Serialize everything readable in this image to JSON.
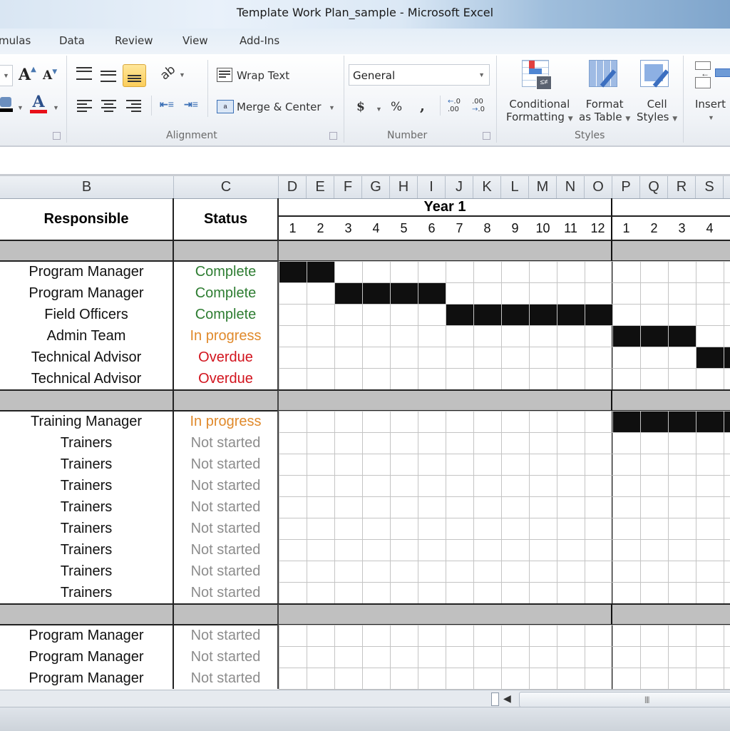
{
  "window": {
    "title": "Template Work Plan_sample  -  Microsoft Excel"
  },
  "ribbon_tabs": [
    "mulas",
    "Data",
    "Review",
    "View",
    "Add-Ins"
  ],
  "ribbon": {
    "font_group": {
      "increase_font_icon": "font-grow-icon",
      "decrease_font_icon": "font-shrink-icon",
      "fill_color_icon": "fill-color-icon",
      "font_color_icon": "font-color-icon"
    },
    "alignment": {
      "label": "Alignment",
      "wrap_text": "Wrap Text",
      "merge_center": "Merge & Center"
    },
    "number": {
      "label": "Number",
      "format_value": "General",
      "currency": "$",
      "percent": "%",
      "comma": ",",
      "increase_decimal": "←.0 .00",
      "decrease_decimal": ".00 →.0"
    },
    "styles": {
      "label": "Styles",
      "conditional_formatting_1": "Conditional",
      "conditional_formatting_2": "Formatting",
      "format_table_1": "Format",
      "format_table_2": "as Table",
      "cell_styles_1": "Cell",
      "cell_styles_2": "Styles"
    },
    "cells": {
      "insert": "Insert"
    }
  },
  "columns": [
    "B",
    "C",
    "D",
    "E",
    "F",
    "G",
    "H",
    "I",
    "J",
    "K",
    "L",
    "M",
    "N",
    "O",
    "P",
    "Q",
    "R",
    "S"
  ],
  "sheet": {
    "header_responsible": "Responsible",
    "header_status": "Status",
    "year_label": "Year 1",
    "months_year1": [
      "1",
      "2",
      "3",
      "4",
      "5",
      "6",
      "7",
      "8",
      "9",
      "10",
      "11",
      "12"
    ],
    "months_year2": [
      "1",
      "2",
      "3",
      "4"
    ],
    "status_colors": {
      "Complete": "#2e7d32",
      "In progress": "#e08a2c",
      "Overdue": "#d2141e",
      "Not started": "#8c8c8c"
    },
    "sections": [
      {
        "rows": [
          {
            "responsible": "Program Manager",
            "status": "Complete",
            "filled_months": [
              1,
              2
            ]
          },
          {
            "responsible": "Program Manager",
            "status": "Complete",
            "filled_months": [
              3,
              4,
              5,
              6
            ]
          },
          {
            "responsible": "Field Officers",
            "status": "Complete",
            "filled_months": [
              7,
              8,
              9,
              10,
              11,
              12
            ]
          },
          {
            "responsible": "Admin Team",
            "status": "In progress",
            "filled_months": [
              13,
              14,
              15
            ]
          },
          {
            "responsible": "Technical Advisor",
            "status": "Overdue",
            "filled_months": [
              16,
              17
            ]
          },
          {
            "responsible": "Technical Advisor",
            "status": "Overdue",
            "filled_months": []
          }
        ]
      },
      {
        "rows": [
          {
            "responsible": "Training Manager",
            "status": "In progress",
            "filled_months": [
              13,
              14,
              15,
              16,
              17
            ]
          },
          {
            "responsible": "Trainers",
            "status": "Not started",
            "filled_months": []
          },
          {
            "responsible": "Trainers",
            "status": "Not started",
            "filled_months": []
          },
          {
            "responsible": "Trainers",
            "status": "Not started",
            "filled_months": []
          },
          {
            "responsible": "Trainers",
            "status": "Not started",
            "filled_months": []
          },
          {
            "responsible": "Trainers",
            "status": "Not started",
            "filled_months": []
          },
          {
            "responsible": "Trainers",
            "status": "Not started",
            "filled_months": []
          },
          {
            "responsible": "Trainers",
            "status": "Not started",
            "filled_months": []
          },
          {
            "responsible": "Trainers",
            "status": "Not started",
            "filled_months": []
          }
        ]
      },
      {
        "rows": [
          {
            "responsible": "Program Manager",
            "status": "Not started",
            "filled_months": []
          },
          {
            "responsible": "Program Manager",
            "status": "Not started",
            "filled_months": []
          },
          {
            "responsible": "Program Manager",
            "status": "Not started",
            "filled_months": []
          }
        ]
      }
    ]
  }
}
